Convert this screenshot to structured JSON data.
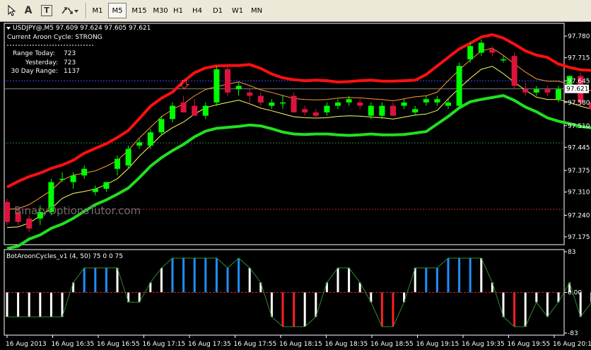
{
  "toolbar": {
    "tools": [
      {
        "name": "cursor-tool",
        "label": ""
      },
      {
        "name": "text-tool",
        "label": "A"
      },
      {
        "name": "text-label-tool",
        "label": "T"
      },
      {
        "name": "arrows-tool",
        "label": ""
      }
    ],
    "timeframes": [
      "M1",
      "M5",
      "M15",
      "M30",
      "H1",
      "H4",
      "D1",
      "W1",
      "MN"
    ],
    "active_timeframe": "M5"
  },
  "chart": {
    "header": "USDJPY@,M5  97.609 97.624 97.605 97.621",
    "aroon_cycle": "Current Aroon Cycle: STRONG",
    "range_today_label": "Range  Today:",
    "range_today_value": "723",
    "yesterday_label": "Yesterday:",
    "yesterday_value": "723",
    "day30_label": "30 Day Range:",
    "day30_value": "1137",
    "watermark": "BinaryOptionsTutor.com",
    "current_price": "97.621",
    "y_ticks": [
      "97.780",
      "97.715",
      "97.645",
      "97.580",
      "97.510",
      "97.445",
      "97.375",
      "97.310",
      "97.240",
      "97.175"
    ],
    "indicator_label": "BotAroonCycles_v1 (4, 50) 75 0 0 75",
    "ind_ticks": [
      "83",
      "0.00",
      "-83"
    ],
    "x_ticks": [
      "16 Aug 2013",
      "16 Aug 16:35",
      "16 Aug 16:55",
      "16 Aug 17:15",
      "16 Aug 17:35",
      "16 Aug 17:55",
      "16 Aug 18:15",
      "16 Aug 18:35",
      "16 Aug 18:55",
      "16 Aug 19:15",
      "16 Aug 19:35",
      "16 Aug 19:55",
      "16 Aug 20:15"
    ],
    "colors": {
      "bull": "#00ff00",
      "bear": "#dc143c",
      "upper_band": "#ff1010",
      "lower_band": "#20e020",
      "mid_orange": "#ff9a30",
      "mid_yellow": "#ffff60",
      "ind_line": "#2e8b2e"
    }
  },
  "chart_data": {
    "type": "candlestick",
    "symbol": "USDJPY@",
    "timeframe": "M5",
    "ylim": [
      97.16,
      97.81
    ],
    "candles": [
      {
        "o": 97.28,
        "h": 97.29,
        "l": 97.21,
        "c": 97.22
      },
      {
        "o": 97.25,
        "h": 97.26,
        "l": 97.21,
        "c": 97.22
      },
      {
        "o": 97.23,
        "h": 97.24,
        "l": 97.19,
        "c": 97.2
      },
      {
        "o": 97.23,
        "h": 97.27,
        "l": 97.21,
        "c": 97.25
      },
      {
        "o": 97.25,
        "h": 97.35,
        "l": 97.24,
        "c": 97.34
      },
      {
        "o": 97.35,
        "h": 97.37,
        "l": 97.34,
        "c": 97.35
      },
      {
        "o": 97.34,
        "h": 97.37,
        "l": 97.32,
        "c": 97.36
      },
      {
        "o": 97.36,
        "h": 97.39,
        "l": 97.35,
        "c": 97.38
      },
      {
        "o": 97.31,
        "h": 97.33,
        "l": 97.3,
        "c": 97.32
      },
      {
        "o": 97.32,
        "h": 97.34,
        "l": 97.31,
        "c": 97.34
      },
      {
        "o": 97.38,
        "h": 97.42,
        "l": 97.36,
        "c": 97.41
      },
      {
        "o": 97.39,
        "h": 97.45,
        "l": 97.38,
        "c": 97.44
      },
      {
        "o": 97.45,
        "h": 97.47,
        "l": 97.44,
        "c": 97.46
      },
      {
        "o": 97.45,
        "h": 97.5,
        "l": 97.44,
        "c": 97.49
      },
      {
        "o": 97.49,
        "h": 97.54,
        "l": 97.48,
        "c": 97.53
      },
      {
        "o": 97.53,
        "h": 97.58,
        "l": 97.52,
        "c": 97.57
      },
      {
        "o": 97.58,
        "h": 97.6,
        "l": 97.55,
        "c": 97.55
      },
      {
        "o": 97.57,
        "h": 97.59,
        "l": 97.54,
        "c": 97.54
      },
      {
        "o": 97.54,
        "h": 97.58,
        "l": 97.53,
        "c": 97.57
      },
      {
        "o": 97.58,
        "h": 97.69,
        "l": 97.57,
        "c": 97.68
      },
      {
        "o": 97.68,
        "h": 97.69,
        "l": 97.6,
        "c": 97.61
      },
      {
        "o": 97.62,
        "h": 97.64,
        "l": 97.6,
        "c": 97.63
      },
      {
        "o": 97.61,
        "h": 97.62,
        "l": 97.58,
        "c": 97.6
      },
      {
        "o": 97.6,
        "h": 97.61,
        "l": 97.57,
        "c": 97.58
      },
      {
        "o": 97.57,
        "h": 97.59,
        "l": 97.56,
        "c": 97.58
      },
      {
        "o": 97.58,
        "h": 97.6,
        "l": 97.56,
        "c": 97.58
      },
      {
        "o": 97.6,
        "h": 97.61,
        "l": 97.55,
        "c": 97.55
      },
      {
        "o": 97.56,
        "h": 97.57,
        "l": 97.54,
        "c": 97.55
      },
      {
        "o": 97.55,
        "h": 97.56,
        "l": 97.53,
        "c": 97.54
      },
      {
        "o": 97.55,
        "h": 97.58,
        "l": 97.54,
        "c": 97.57
      },
      {
        "o": 97.57,
        "h": 97.59,
        "l": 97.56,
        "c": 97.58
      },
      {
        "o": 97.58,
        "h": 97.6,
        "l": 97.57,
        "c": 97.59
      },
      {
        "o": 97.58,
        "h": 97.59,
        "l": 97.56,
        "c": 97.57
      },
      {
        "o": 97.54,
        "h": 97.58,
        "l": 97.53,
        "c": 97.57
      },
      {
        "o": 97.54,
        "h": 97.58,
        "l": 97.53,
        "c": 97.57
      },
      {
        "o": 97.57,
        "h": 97.58,
        "l": 97.54,
        "c": 97.54
      },
      {
        "o": 97.57,
        "h": 97.59,
        "l": 97.56,
        "c": 97.58
      },
      {
        "o": 97.55,
        "h": 97.57,
        "l": 97.54,
        "c": 97.56
      },
      {
        "o": 97.58,
        "h": 97.6,
        "l": 97.57,
        "c": 97.59
      },
      {
        "o": 97.58,
        "h": 97.6,
        "l": 97.57,
        "c": 97.59
      },
      {
        "o": 97.57,
        "h": 97.59,
        "l": 97.56,
        "c": 97.58
      },
      {
        "o": 97.57,
        "h": 97.7,
        "l": 97.56,
        "c": 97.69
      },
      {
        "o": 97.71,
        "h": 97.76,
        "l": 97.7,
        "c": 97.75
      },
      {
        "o": 97.73,
        "h": 97.77,
        "l": 97.72,
        "c": 97.76
      },
      {
        "o": 97.74,
        "h": 97.75,
        "l": 97.72,
        "c": 97.73
      },
      {
        "o": 97.71,
        "h": 97.72,
        "l": 97.7,
        "c": 97.71
      },
      {
        "o": 97.72,
        "h": 97.73,
        "l": 97.62,
        "c": 97.63
      },
      {
        "o": 97.62,
        "h": 97.64,
        "l": 97.6,
        "c": 97.61
      },
      {
        "o": 97.61,
        "h": 97.63,
        "l": 97.6,
        "c": 97.62
      },
      {
        "o": 97.62,
        "h": 97.63,
        "l": 97.6,
        "c": 97.61
      },
      {
        "o": 97.59,
        "h": 97.63,
        "l": 97.58,
        "c": 97.62
      },
      {
        "o": 97.63,
        "h": 97.66,
        "l": 97.62,
        "c": 97.66
      },
      {
        "o": 97.66,
        "h": 97.67,
        "l": 97.57,
        "c": 97.58
      },
      {
        "o": 97.58,
        "h": 97.59,
        "l": 97.55,
        "c": 97.56
      },
      {
        "o": 97.56,
        "h": 97.57,
        "l": 97.55,
        "c": 97.56
      },
      {
        "o": 97.57,
        "h": 97.58,
        "l": 97.54,
        "c": 97.55
      }
    ],
    "indicator": {
      "name": "BotAroonCycles_v1",
      "ylim": [
        -83,
        83
      ],
      "values": [
        -50,
        -50,
        -50,
        -50,
        -50,
        -50,
        20,
        50,
        50,
        50,
        50,
        -20,
        -20,
        20,
        50,
        70,
        70,
        70,
        70,
        70,
        50,
        70,
        50,
        20,
        -50,
        -70,
        -70,
        -70,
        -50,
        20,
        50,
        50,
        20,
        -20,
        -70,
        -70,
        -20,
        50,
        50,
        50,
        70,
        70,
        70,
        70,
        20,
        -50,
        -70,
        -70,
        -20,
        -50,
        -20,
        20,
        -50,
        -20,
        -70,
        -70
      ],
      "colors": [
        "w",
        "w",
        "w",
        "w",
        "w",
        "w",
        "w",
        "b",
        "b",
        "b",
        "w",
        "w",
        "w",
        "w",
        "w",
        "b",
        "b",
        "b",
        "b",
        "b",
        "b",
        "b",
        "w",
        "w",
        "w",
        "r",
        "r",
        "w",
        "w",
        "w",
        "w",
        "w",
        "w",
        "w",
        "r",
        "r",
        "w",
        "w",
        "b",
        "b",
        "b",
        "b",
        "b",
        "w",
        "w",
        "w",
        "r",
        "w",
        "w",
        "w",
        "w",
        "w",
        "w",
        "w",
        "r",
        "w"
      ]
    }
  }
}
